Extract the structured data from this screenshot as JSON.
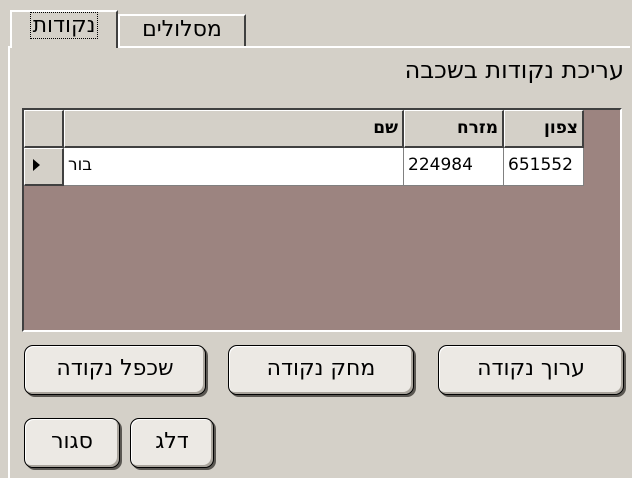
{
  "tabs": [
    {
      "label": "נקודות",
      "active": true
    },
    {
      "label": "מסלולים",
      "active": false
    }
  ],
  "heading": "עריכת נקודות בשכבה",
  "grid": {
    "columns": [
      "שם",
      "מזרח",
      "צפון"
    ],
    "rows": [
      {
        "name": "בור",
        "east": "224984",
        "north": "651552"
      }
    ]
  },
  "buttons": {
    "edit_point": "ערוך נקודה",
    "delete_point": "מחק נקודה",
    "duplicate_point": "שכפל נקודה",
    "skip": "דלג",
    "close": "סגור"
  },
  "colors": {
    "window_bg": "#d4d0c8",
    "grid_bg": "#9c8480",
    "cell_bg": "#ffffff"
  }
}
